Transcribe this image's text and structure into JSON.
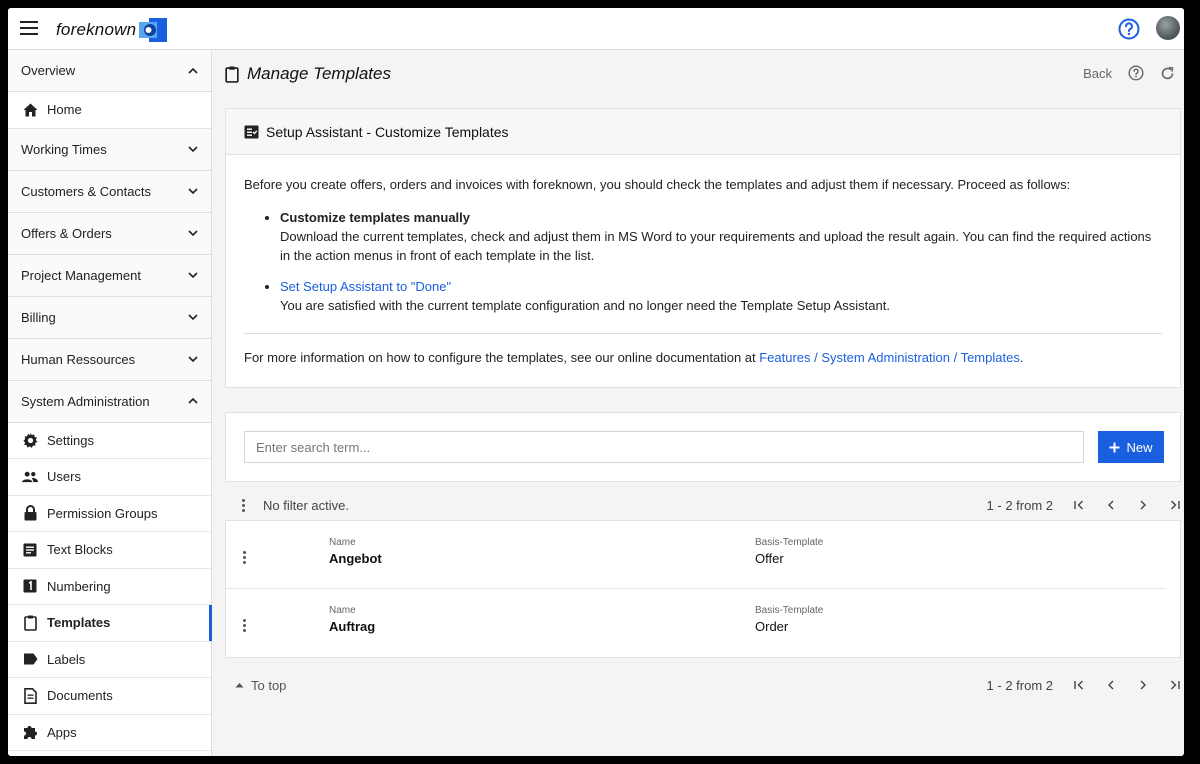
{
  "header": {
    "logo_text": "foreknown",
    "help_icon": "help-circle-icon",
    "avatar_icon": "user-avatar"
  },
  "sidebar": {
    "groups": [
      {
        "label": "Overview",
        "expanded": true,
        "items": [
          {
            "label": "Home",
            "icon": "home-icon"
          }
        ]
      },
      {
        "label": "Working Times",
        "expanded": false
      },
      {
        "label": "Customers & Contacts",
        "expanded": false
      },
      {
        "label": "Offers & Orders",
        "expanded": false
      },
      {
        "label": "Project Management",
        "expanded": false
      },
      {
        "label": "Billing",
        "expanded": false
      },
      {
        "label": "Human Ressources",
        "expanded": false
      },
      {
        "label": "System Administration",
        "expanded": true
      }
    ],
    "admin_items": [
      {
        "label": "Settings",
        "icon": "gear-icon"
      },
      {
        "label": "Users",
        "icon": "users-icon"
      },
      {
        "label": "Permission Groups",
        "icon": "lock-icon"
      },
      {
        "label": "Text Blocks",
        "icon": "text-block-icon"
      },
      {
        "label": "Numbering",
        "icon": "numbering-icon"
      },
      {
        "label": "Templates",
        "icon": "clipboard-icon",
        "active": true
      },
      {
        "label": "Labels",
        "icon": "label-icon"
      },
      {
        "label": "Documents",
        "icon": "document-icon"
      },
      {
        "label": "Apps",
        "icon": "puzzle-icon"
      }
    ]
  },
  "page": {
    "title": "Manage Templates",
    "back_label": "Back"
  },
  "assistant": {
    "title": "Setup Assistant - Customize Templates",
    "intro": "Before you create offers, orders and invoices with foreknown, you should check the templates and adjust them if necessary. Proceed as follows:",
    "step1_title": "Customize templates manually",
    "step1_text": "Download the current templates, check and adjust them in MS Word to your requirements and upload the result again. You can find the required actions in the action menus in front of each template in the list.",
    "step2_link": "Set Setup Assistant to \"Done\"",
    "step2_text": "You are satisfied with the current template configuration and no longer need the Template Setup Assistant.",
    "more_prefix": "For more information on how to configure the templates, see our online documentation at ",
    "more_link": "Features / System Administration / Templates",
    "more_suffix": "."
  },
  "search": {
    "placeholder": "Enter search term...",
    "new_label": "New"
  },
  "filter": {
    "status": "No filter active.",
    "range": "1 - 2 from 2"
  },
  "table": {
    "columns": [
      "Name",
      "Basis-Template"
    ],
    "rows": [
      {
        "name": "Angebot",
        "basis": "Offer"
      },
      {
        "name": "Auftrag",
        "basis": "Order"
      }
    ]
  },
  "footer": {
    "to_top": "To top",
    "range": "1 - 2 from 2"
  },
  "colors": {
    "accent": "#1a5fe0",
    "link": "#1a5fe0"
  }
}
